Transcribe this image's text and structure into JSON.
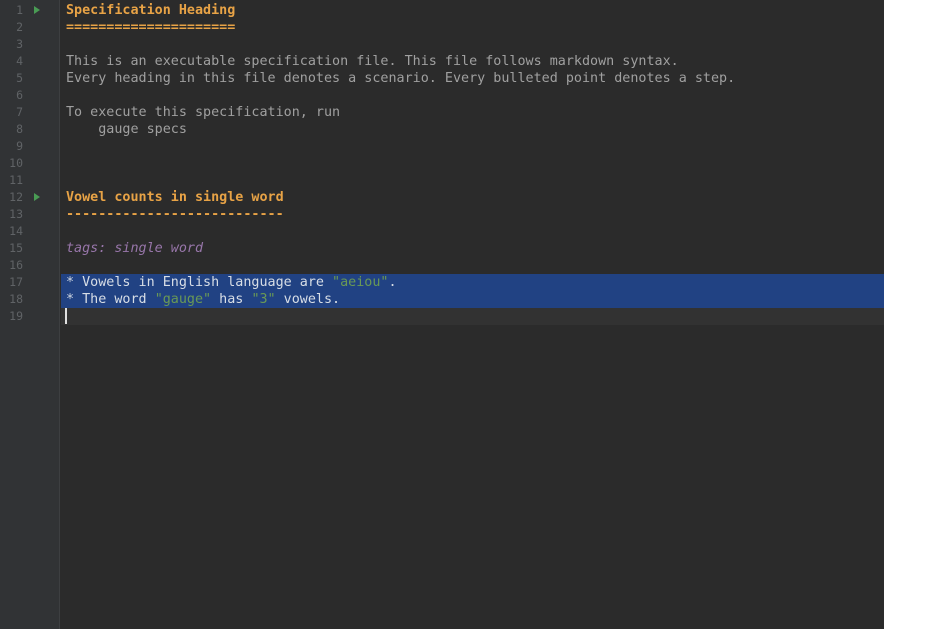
{
  "gutter": {
    "line_numbers": [
      "1",
      "2",
      "3",
      "4",
      "5",
      "6",
      "7",
      "8",
      "9",
      "10",
      "11",
      "12",
      "13",
      "14",
      "15",
      "16",
      "17",
      "18",
      "19"
    ],
    "run_icon_lines": [
      1,
      12
    ]
  },
  "lines": {
    "l1": "Specification Heading",
    "l2": "=====================",
    "l4": "This is an executable specification file. This file follows markdown syntax.",
    "l5": "Every heading in this file denotes a scenario. Every bulleted point denotes a step.",
    "l7": "To execute this specification, run",
    "l8": "    gauge specs",
    "l12": "Vowel counts in single word",
    "l13": "---------------------------",
    "l15": "tags: single word",
    "l17": {
      "bullet": "*",
      "text_before": " Vowels in English language are ",
      "param": "\"aeiou\"",
      "text_after": "."
    },
    "l18": {
      "bullet": "*",
      "text_before": " The word ",
      "param1": "\"gauge\"",
      "text_mid": " has ",
      "param2": "\"3\"",
      "text_after": " vowels."
    }
  },
  "colors": {
    "editor_bg": "#2b2b2b",
    "gutter_bg": "#313335",
    "heading": "#e8a346",
    "selection": "#214283",
    "tag": "#9876aa",
    "param": "#6a9955",
    "run_icon": "#499c54"
  },
  "icons": [
    "run-gutter-icon"
  ]
}
